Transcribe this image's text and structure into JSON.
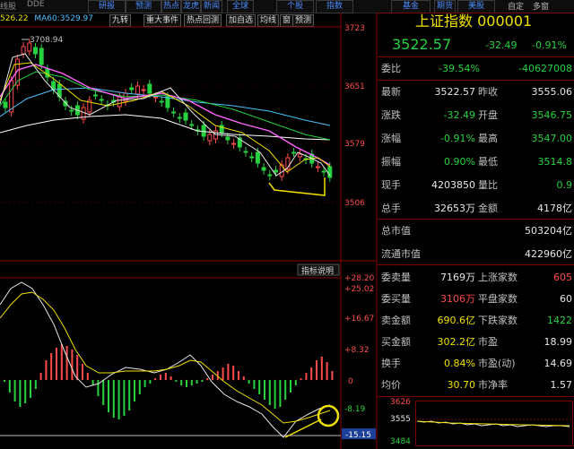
{
  "toolbar": {
    "left_items": [
      "线股",
      "DDE"
    ],
    "buttons": [
      "研报",
      "预测",
      "热点",
      "龙虎",
      "新闻",
      "全球",
      "个股",
      "指数",
      "基金",
      "期货",
      "美股",
      "自定",
      "多窗"
    ]
  },
  "chart_header": {
    "ma5_value": "526.22",
    "ma60_label": "MA60:",
    "ma60_value": "3529.97",
    "tool_buttons": [
      "九转",
      "重大事件",
      "热点回测",
      "加自选",
      "均线",
      "窗",
      "预测"
    ]
  },
  "main_chart": {
    "peak_label": "3708.94",
    "price_ticks": [
      "3723",
      "3651",
      "3579",
      "3506"
    ]
  },
  "indicator_button": "指标说明",
  "macd": {
    "ticks_red": [
      "+28.20",
      "+25.02",
      "+16.67",
      "+8.32"
    ],
    "tick_zero": "0",
    "ticks_green": [
      "-8.19",
      "-15.15"
    ],
    "highlight_value": "-15.15"
  },
  "quote": {
    "title": "上证指数",
    "code": "000001",
    "price": "3522.57",
    "change": "-32.49",
    "change_pct": "-0.91%",
    "wb_label": "委比",
    "wb_value": "-39.54%",
    "wb_diff": "-40627008",
    "rows": [
      {
        "l1": "最新",
        "v1": "3522.57",
        "c1": "white",
        "l2": "昨收",
        "v2": "3555.06",
        "c2": "white"
      },
      {
        "l1": "涨跌",
        "v1": "-32.49",
        "c1": "green",
        "l2": "开盘",
        "v2": "3546.75",
        "c2": "green"
      },
      {
        "l1": "涨幅",
        "v1": "-0.91%",
        "c1": "green",
        "l2": "最高",
        "v2": "3547.00",
        "c2": "green"
      },
      {
        "l1": "振幅",
        "v1": "0.90%",
        "c1": "green",
        "l2": "最低",
        "v2": "3514.8",
        "c2": "green"
      },
      {
        "l1": "现手",
        "v1": "4203850",
        "c1": "white",
        "l2": "量比",
        "v2": "0.9",
        "c2": "green"
      },
      {
        "l1": "总手",
        "v1": "32653万",
        "c1": "white",
        "l2": "金额",
        "v2": "4178亿",
        "c2": "white"
      }
    ],
    "total_mv_label": "总市值",
    "total_mv": "503204亿",
    "float_mv_label": "流通市值",
    "float_mv": "422960亿",
    "bottom_rows": [
      {
        "l1": "委卖量",
        "v1": "7169万",
        "c1": "white",
        "l2": "上涨家数",
        "v2": "605",
        "c2": "red"
      },
      {
        "l1": "委买量",
        "v1": "3106万",
        "c1": "red",
        "l2": "平盘家数",
        "v2": "60",
        "c2": "white"
      },
      {
        "l1": "卖金额",
        "v1": "690.6亿",
        "c1": "yellow",
        "l2": "下跌家数",
        "v2": "1422",
        "c2": "green"
      },
      {
        "l1": "买金额",
        "v1": "302.2亿",
        "c1": "yellow",
        "l2": "市盈",
        "v2": "18.99",
        "c2": "white"
      },
      {
        "l1": "换手",
        "v1": "0.84%",
        "c1": "yellow",
        "l2": "市盈(动)",
        "v2": "14.69",
        "c2": "white"
      },
      {
        "l1": "均价",
        "v1": "30.70",
        "c1": "yellow",
        "l2": "市净率",
        "v2": "1.57",
        "c2": "white"
      }
    ],
    "mini_ticks": [
      "3626",
      "3555",
      "3484"
    ]
  },
  "colors": {
    "up": "#ff4b4b",
    "down": "#27d13f",
    "ma5": "#e6e6e6",
    "ma10": "#f0e000",
    "ma20": "#ff66ff",
    "ma30": "#27d13f",
    "ma60": "#4fc0ff",
    "ma120": "#ffffff",
    "annotation": "#f0e000",
    "title": "#f0e000",
    "border": "#a01010"
  }
}
